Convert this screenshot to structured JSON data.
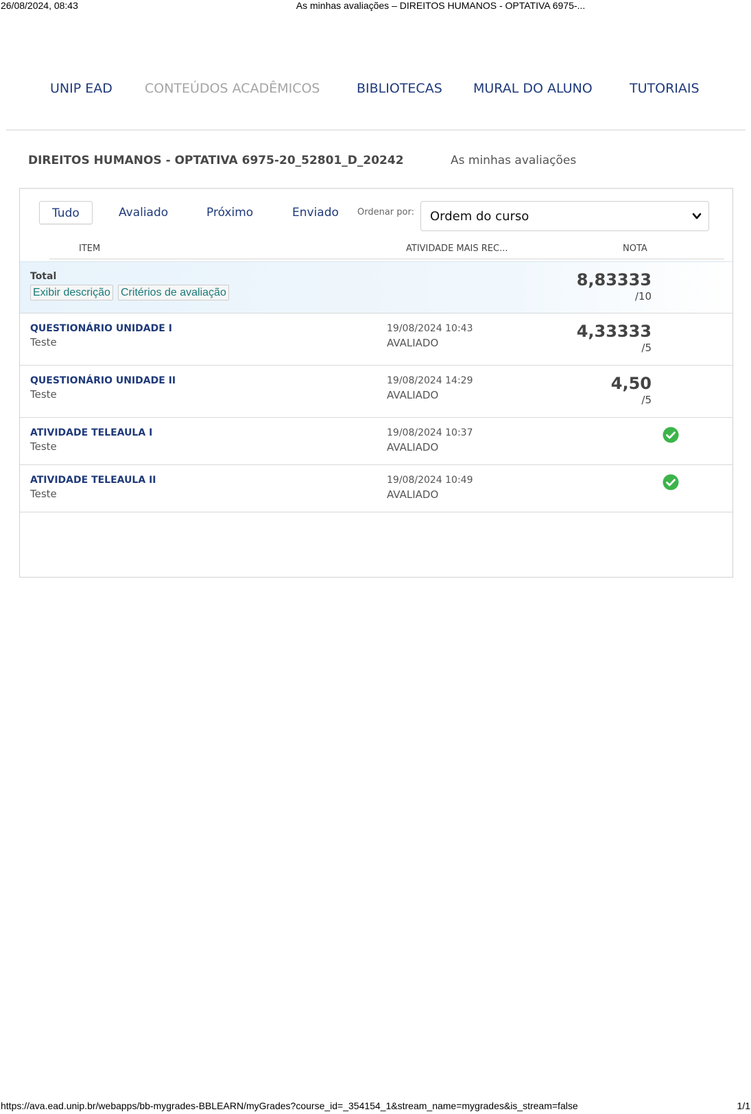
{
  "print": {
    "datetime": "26/08/2024, 08:43",
    "doc_title": "As minhas avaliações – DIREITOS HUMANOS - OPTATIVA 6975-...",
    "url": "https://ava.ead.unip.br/webapps/bb-mygrades-BBLEARN/myGrades?course_id=_354154_1&stream_name=mygrades&is_stream=false",
    "page_num": "1/1"
  },
  "nav": {
    "items": [
      {
        "label": "UNIP EAD"
      },
      {
        "label": "CONTEÚDOS ACADÊMICOS"
      },
      {
        "label": "BIBLIOTECAS"
      },
      {
        "label": "MURAL DO ALUNO"
      },
      {
        "label": "TUTORIAIS"
      }
    ],
    "active_index": 1
  },
  "course": {
    "title": "DIREITOS HUMANOS - OPTATIVA 6975-20_52801_D_20242",
    "subtitle": "As minhas avaliações"
  },
  "filters": {
    "tabs": [
      {
        "label": "Tudo"
      },
      {
        "label": "Avaliado"
      },
      {
        "label": "Próximo"
      },
      {
        "label": "Enviado"
      }
    ],
    "active_index": 0,
    "sort_label": "Ordenar por:",
    "sort_value": "Ordem do curso"
  },
  "columns": {
    "item": "ITEM",
    "activity": "ATIVIDADE MAIS REC...",
    "grade": "NOTA"
  },
  "total": {
    "label": "Total",
    "show_description": "Exibir descrição",
    "criteria": "Critérios de avaliação",
    "grade": "8,83333",
    "max": "/10"
  },
  "rows": [
    {
      "title": "QUESTIONÁRIO UNIDADE I",
      "type": "Teste",
      "date": "19/08/2024 10:43",
      "status": "AVALIADO",
      "grade": "4,33333",
      "max": "/5"
    },
    {
      "title": "QUESTIONÁRIO UNIDADE II",
      "type": "Teste",
      "date": "19/08/2024 14:29",
      "status": "AVALIADO",
      "grade": "4,50",
      "max": "/5"
    },
    {
      "title": "ATIVIDADE TELEAULA I",
      "type": "Teste",
      "date": "19/08/2024 10:37",
      "status": "AVALIADO",
      "icon": "check-circle-icon"
    },
    {
      "title": "ATIVIDADE TELEAULA II",
      "type": "Teste",
      "date": "19/08/2024 10:49",
      "status": "AVALIADO",
      "icon": "check-circle-icon"
    }
  ],
  "colors": {
    "link": "#1f3a7a",
    "nav_active": "#a5a5a5",
    "teal_link": "#1a7a7a",
    "success": "#3cb44a"
  }
}
